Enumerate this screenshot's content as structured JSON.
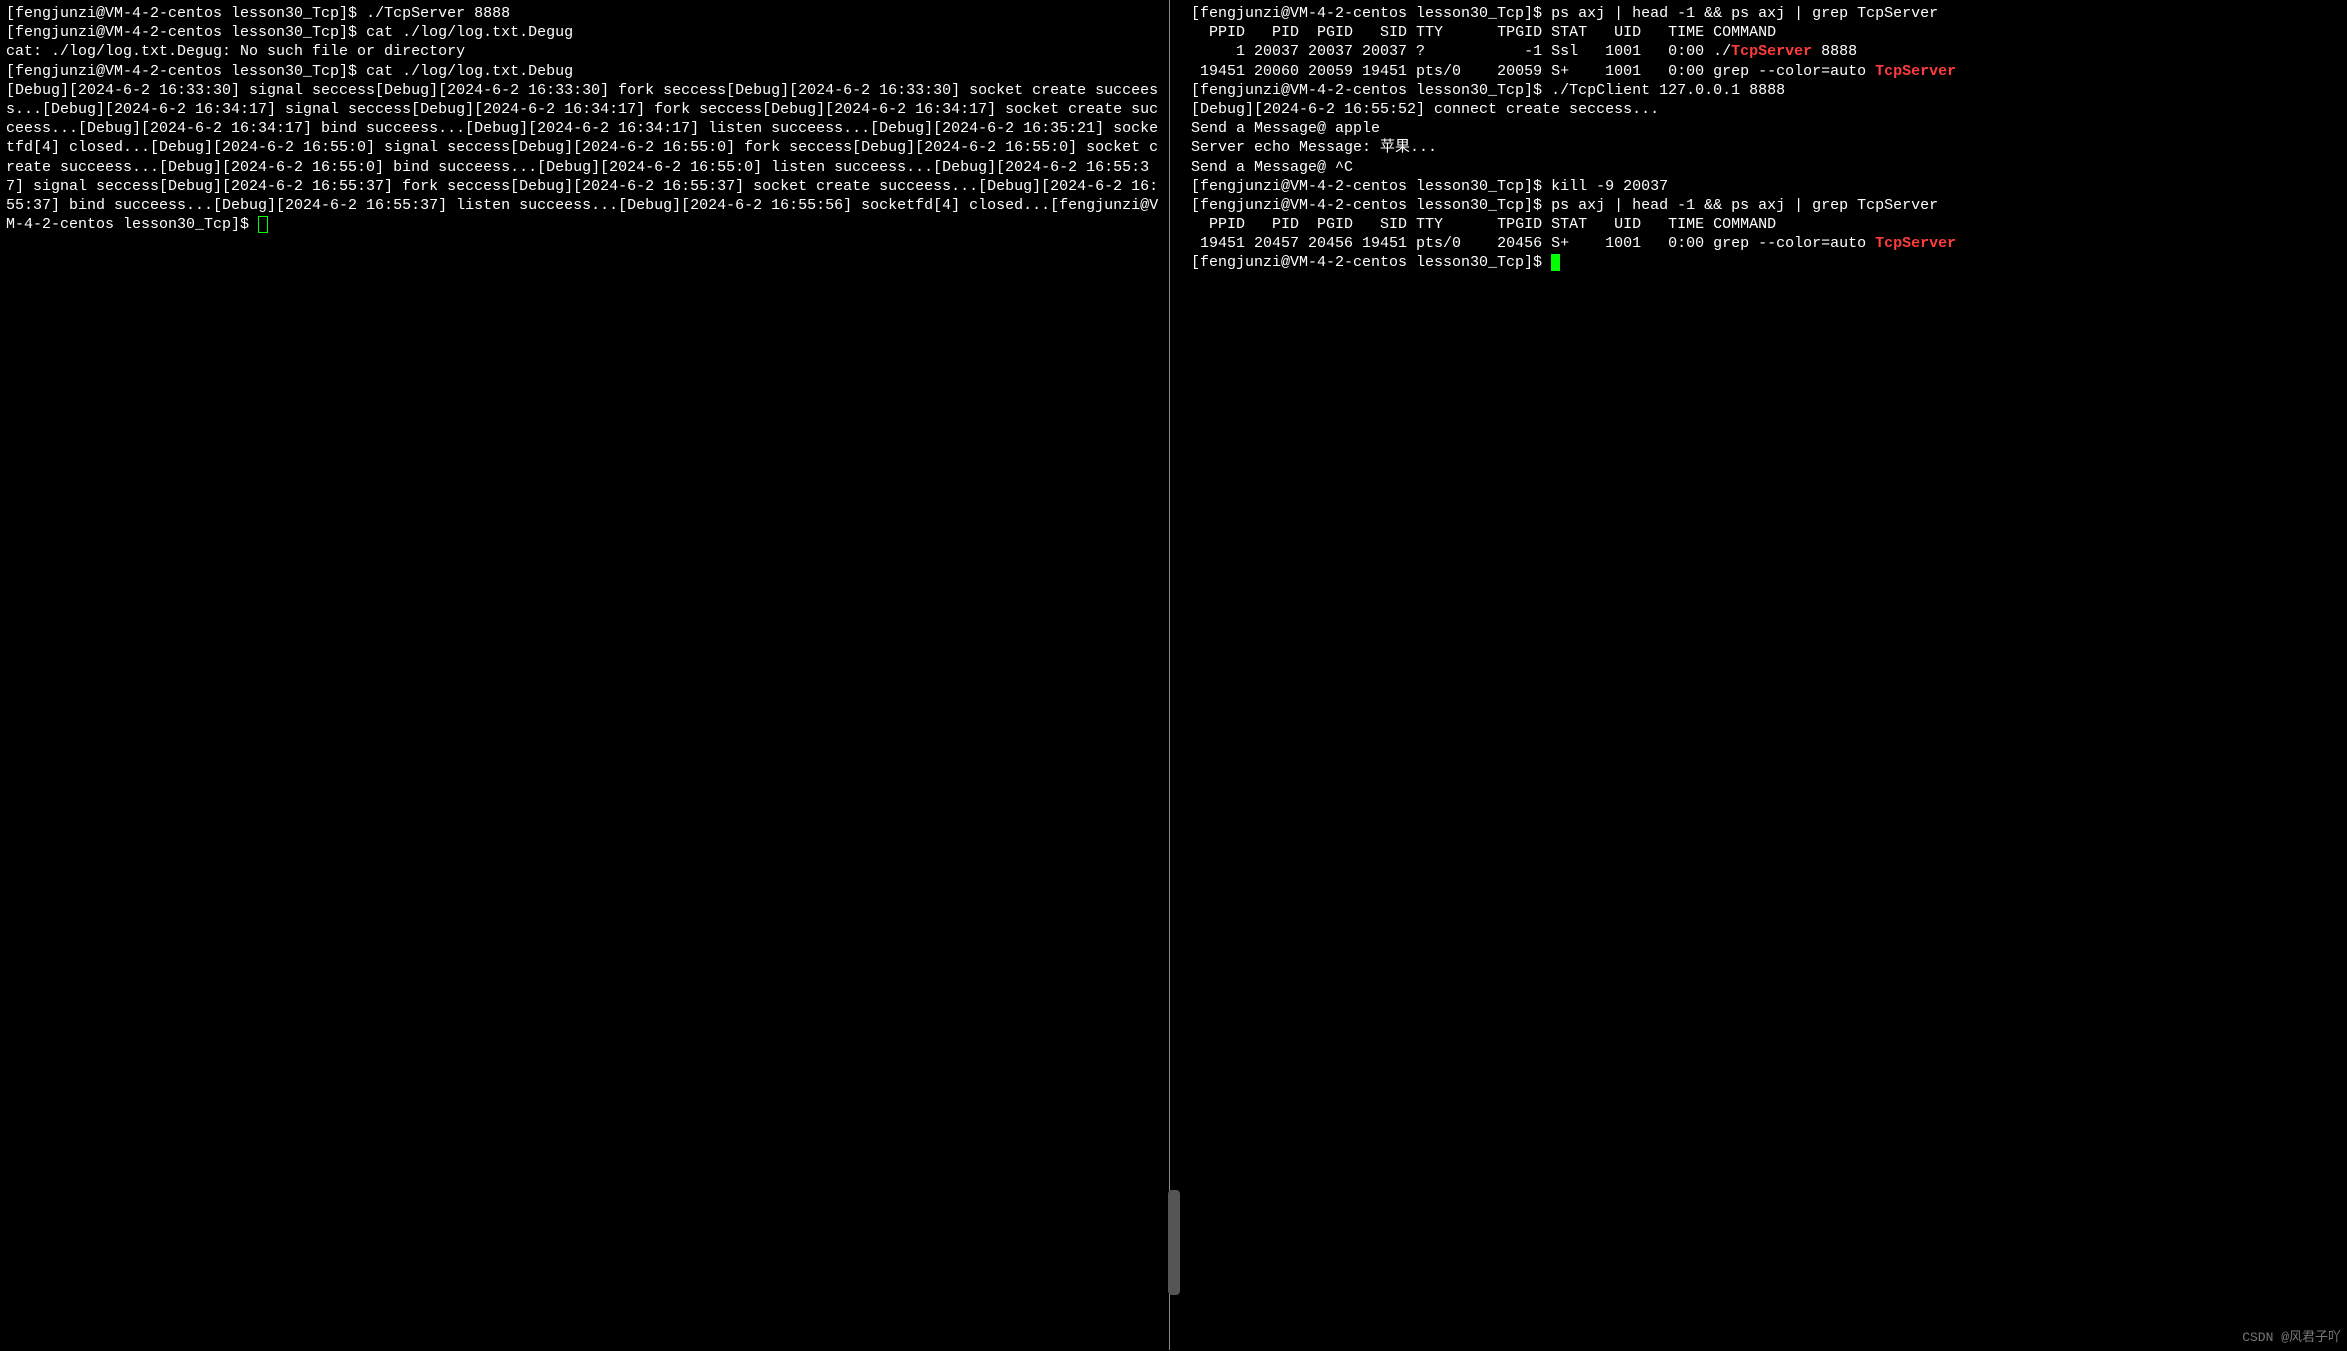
{
  "left": {
    "l1_prompt": "[fengjunzi@VM-4-2-centos lesson30_Tcp]$ ",
    "l1_cmd": "./TcpServer 8888",
    "l2_prompt": "[fengjunzi@VM-4-2-centos lesson30_Tcp]$ ",
    "l2_cmd": "cat ./log/log.txt.Degug",
    "l3": "cat: ./log/log.txt.Degug: No such file or directory",
    "l4_prompt": "[fengjunzi@VM-4-2-centos lesson30_Tcp]$ ",
    "l4_cmd": "cat ./log/log.txt.Debug",
    "log_body": "[Debug][2024-6-2 16:33:30] signal seccess[Debug][2024-6-2 16:33:30] fork seccess[Debug][2024-6-2 16:33:30] socket create succeess...[Debug][2024-6-2 16:34:17] signal seccess[Debug][2024-6-2 16:34:17] fork seccess[Debug][2024-6-2 16:34:17] socket create succeess...[Debug][2024-6-2 16:34:17] bind succeess...[Debug][2024-6-2 16:34:17] listen succeess...[Debug][2024-6-2 16:35:21] socketfd[4] closed...[Debug][2024-6-2 16:55:0] signal seccess[Debug][2024-6-2 16:55:0] fork seccess[Debug][2024-6-2 16:55:0] socket create succeess...[Debug][2024-6-2 16:55:0] bind succeess...[Debug][2024-6-2 16:55:0] listen succeess...[Debug][2024-6-2 16:55:37] signal seccess[Debug][2024-6-2 16:55:37] fork seccess[Debug][2024-6-2 16:55:37] socket create succeess...[Debug][2024-6-2 16:55:37] bind succeess...[Debug][2024-6-2 16:55:37] listen succeess...[Debug][2024-6-2 16:55:56] socketfd[4] closed...",
    "end_prompt": "[fengjunzi@VM-4-2-centos lesson30_Tcp]$ "
  },
  "right": {
    "r1_prompt": "[fengjunzi@VM-4-2-centos lesson30_Tcp]$ ",
    "r1_cmd": "ps axj | head -1 && ps axj | grep TcpServer",
    "header": "  PPID   PID  PGID   SID TTY      TPGID STAT   UID   TIME COMMAND",
    "row1_a": "     1 20037 20037 20037 ?           -1 Ssl   1001   0:00 ./",
    "row1_hl": "TcpServer",
    "row1_b": " 8888",
    "row2_a": " 19451 20060 20059 19451 pts/0    20059 S+    1001   0:00 grep --color=auto ",
    "row2_hl": "TcpServer",
    "r2_prompt": "[fengjunzi@VM-4-2-centos lesson30_Tcp]$ ",
    "r2_cmd": "./TcpClient 127.0.0.1 8888",
    "r3": "[Debug][2024-6-2 16:55:52] connect create seccess...",
    "r4": "Send a Message@ apple",
    "r5": "Server echo Message: 苹果...",
    "r6": "Send a Message@ ^C",
    "r7_prompt": "[fengjunzi@VM-4-2-centos lesson30_Tcp]$ ",
    "r7_cmd": "kill -9 20037",
    "r8_prompt": "[fengjunzi@VM-4-2-centos lesson30_Tcp]$ ",
    "r8_cmd": "ps axj | head -1 && ps axj | grep TcpServer",
    "header2": "  PPID   PID  PGID   SID TTY      TPGID STAT   UID   TIME COMMAND",
    "row3_a": " 19451 20457 20456 19451 pts/0    20456 S+    1001   0:00 grep --color=auto ",
    "row3_hl": "TcpServer",
    "end_prompt": "[fengjunzi@VM-4-2-centos lesson30_Tcp]$ "
  },
  "watermark": "CSDN @风君子吖"
}
